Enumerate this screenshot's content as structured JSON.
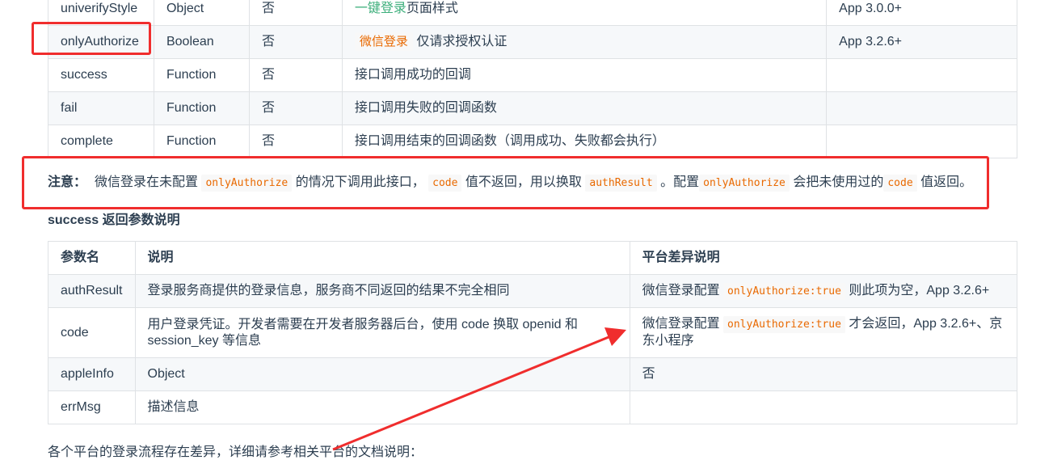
{
  "param_table": {
    "rows": [
      {
        "name": "univerifyStyle",
        "type": "Object",
        "required": "否",
        "desc_link": "一键登录",
        "desc_text": "页面样式",
        "platform": "App 3.0.0+"
      },
      {
        "name": "onlyAuthorize",
        "type": "Boolean",
        "required": "否",
        "desc_tag": "微信登录",
        "desc_text": "仅请求授权认证",
        "platform": "App 3.2.6+"
      },
      {
        "name": "success",
        "type": "Function",
        "required": "否",
        "desc_text": "接口调用成功的回调",
        "platform": ""
      },
      {
        "name": "fail",
        "type": "Function",
        "required": "否",
        "desc_text": "接口调用失败的回调函数",
        "platform": ""
      },
      {
        "name": "complete",
        "type": "Function",
        "required": "否",
        "desc_text": "接口调用结束的回调函数（调用成功、失败都会执行）",
        "platform": ""
      }
    ]
  },
  "note": {
    "label": "注意：",
    "t1": "微信登录在未配置",
    "c1": "onlyAuthorize",
    "t2": "的情况下调用此接口，",
    "c2": "code",
    "t3": "值不返回，用以换取",
    "c3": "authResult",
    "t4": "。配置",
    "c4": "onlyAuthorize",
    "t5": "会把未使用过的",
    "c5": "code",
    "t6": "值返回。"
  },
  "success_title": "success 返回参数说明",
  "result_table": {
    "headers": [
      "参数名",
      "说明",
      "平台差异说明"
    ],
    "rows": [
      {
        "name": "authResult",
        "desc": "登录服务商提供的登录信息，服务商不同返回的结果不完全相同",
        "p1": "微信登录配置",
        "pcode": "onlyAuthorize:true",
        "p2": "则此项为空，App 3.2.6+"
      },
      {
        "name": "code",
        "desc": "用户登录凭证。开发者需要在开发者服务器后台，使用 code 换取 openid 和 session_key 等信息",
        "p1": "微信登录配置",
        "pcode": "onlyAuthorize:true",
        "p2": "才会返回，App 3.2.6+、京东小程序"
      },
      {
        "name": "appleInfo",
        "desc": "Object",
        "p1": "否",
        "pcode": "",
        "p2": ""
      },
      {
        "name": "errMsg",
        "desc": "描述信息",
        "p1": "",
        "pcode": "",
        "p2": ""
      }
    ]
  },
  "bottom_text": "各个平台的登录流程存在差异，详细请参考相关平台的文档说明：",
  "colors": {
    "annotation_red": "#f02d2d",
    "code_orange": "#e96900",
    "link_green": "#3eaf7c"
  }
}
